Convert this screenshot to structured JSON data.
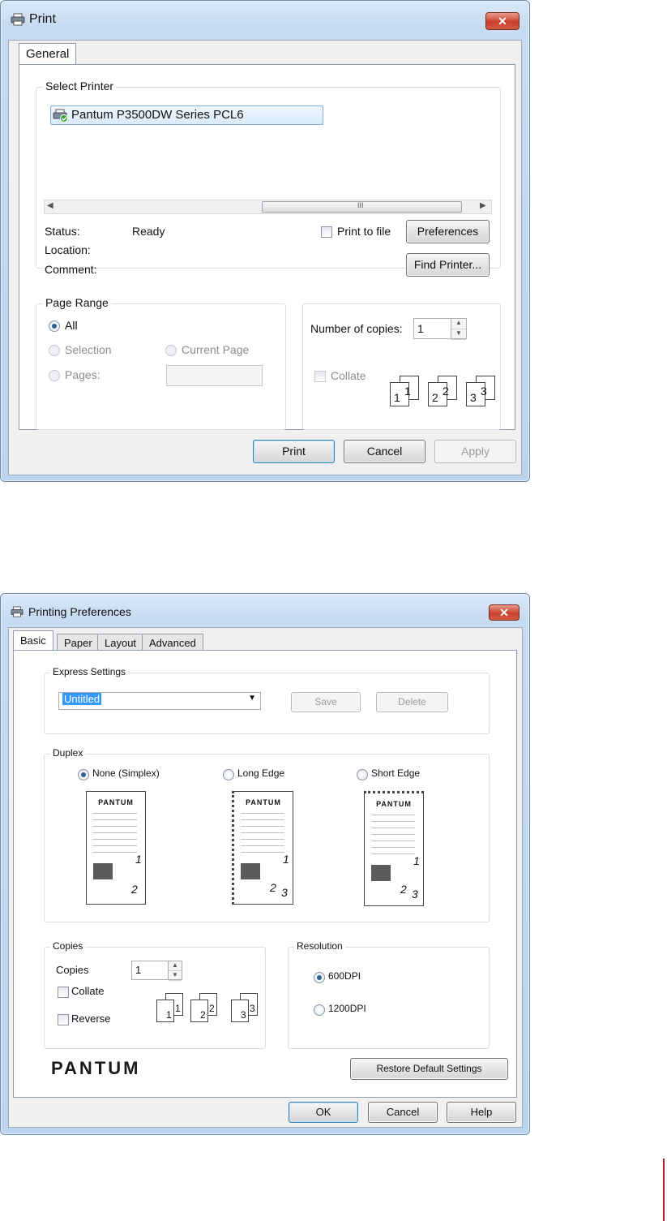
{
  "print_dialog": {
    "title": "Print",
    "tab": "General",
    "select_printer_legend": "Select Printer",
    "printer_name": "Pantum P3500DW Series PCL6",
    "scroll_thumb_glyph": "III",
    "status_label": "Status:",
    "status_value": "Ready",
    "location_label": "Location:",
    "comment_label": "Comment:",
    "print_to_file_label": "Print to file",
    "preferences_button": "Preferences",
    "find_printer_button": "Find Printer...",
    "page_range_legend": "Page Range",
    "range_all": "All",
    "range_selection": "Selection",
    "range_current_page": "Current Page",
    "range_pages": "Pages:",
    "copies_label": "Number of copies:",
    "copies_value": "1",
    "collate_label": "Collate",
    "buttons": {
      "print": "Print",
      "cancel": "Cancel",
      "apply": "Apply"
    }
  },
  "preferences_dialog": {
    "title": "Printing Preferences",
    "tabs": [
      "Basic",
      "Paper",
      "Layout",
      "Advanced"
    ],
    "express_settings_legend": "Express Settings",
    "express_value": "Untitled",
    "save_button": "Save",
    "delete_button": "Delete",
    "duplex_legend": "Duplex",
    "duplex_options": [
      "None (Simplex)",
      "Long Edge",
      "Short Edge"
    ],
    "brand_on_page": "PANTUM",
    "copies_legend": "Copies",
    "copies_label": "Copies",
    "copies_value": "1",
    "collate_label": "Collate",
    "reverse_label": "Reverse",
    "resolution_legend": "Resolution",
    "resolution_options": [
      "600DPI",
      "1200DPI"
    ],
    "logo_text": "PANTUM",
    "restore_button": "Restore Default Settings",
    "buttons": {
      "ok": "OK",
      "cancel": "Cancel",
      "help": "Help"
    }
  },
  "icons": {
    "printer": "printer-icon",
    "close": "close-icon",
    "spinner": "spinner-arrows-icon",
    "dropdown": "chevron-down-icon"
  },
  "colors": {
    "title_bar": "#c7dbf2",
    "close_button": "#c8412b",
    "selection": "#3399ff"
  }
}
